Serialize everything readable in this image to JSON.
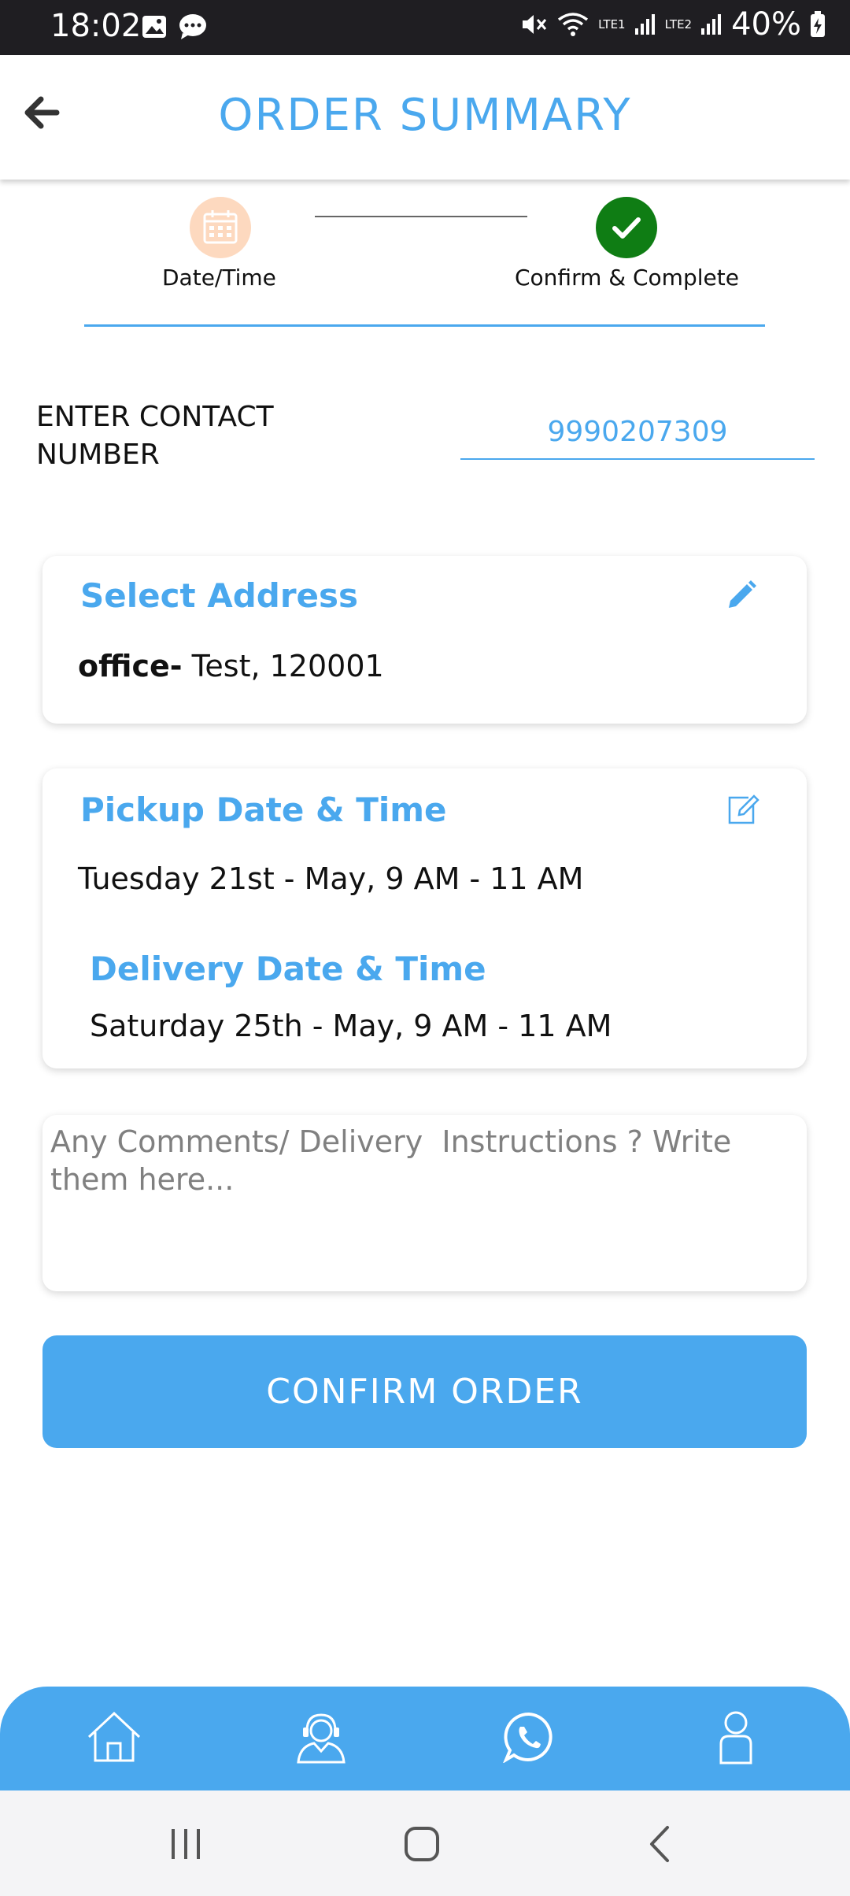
{
  "status_bar": {
    "time": "18:02",
    "battery": "40%",
    "network1": "LTE1",
    "network2": "LTE2"
  },
  "header": {
    "title": "ORDER SUMMARY"
  },
  "stepper": {
    "steps": [
      {
        "label": "Date/Time",
        "state": "inactive"
      },
      {
        "label": "Confirm & Complete",
        "state": "complete"
      }
    ]
  },
  "contact": {
    "label": "ENTER CONTACT NUMBER",
    "value": "9990207309"
  },
  "address_card": {
    "title": "Select Address",
    "address_type": "office-",
    "address_text": " Test, 120001"
  },
  "dates_card": {
    "pickup_title": "Pickup Date & Time",
    "pickup_value": "Tuesday 21st - May, 9 AM - 11 AM",
    "delivery_title": "Delivery Date & Time",
    "delivery_value": "Saturday 25th - May, 9 AM - 11 AM"
  },
  "comments": {
    "placeholder": "Any Comments/ Delivery  Instructions ? Write them here..."
  },
  "confirm_button": {
    "label": "CONFIRM ORDER"
  },
  "bottom_nav": {
    "items": [
      "home-icon",
      "support-agent-icon",
      "whatsapp-icon",
      "profile-icon"
    ]
  },
  "colors": {
    "accent": "#4aa8ee",
    "success": "#0f7d14",
    "step_inactive": "#fdd9bf"
  }
}
